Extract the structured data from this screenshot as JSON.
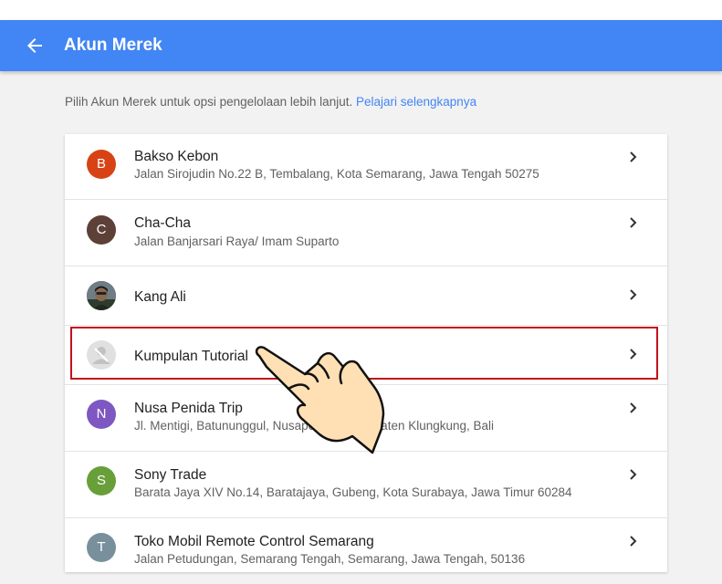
{
  "header": {
    "title": "Akun Merek",
    "back_icon": "arrow-back-icon",
    "bar_color": "#4285f4"
  },
  "intro": {
    "text": "Pilih Akun Merek untuk opsi pengelolaan lebih lanjut.",
    "link": "Pelajari selengkapnya"
  },
  "accounts": [
    {
      "initial": "B",
      "name": "Bakso Kebon",
      "address": "Jalan Sirojudin No.22 B, Tembalang, Kota Semarang, Jawa Tengah 50275",
      "color": "#d84315"
    },
    {
      "initial": "C",
      "name": "Cha-Cha",
      "address": "Jalan Banjarsari Raya/ Imam Suparto",
      "color": "#5d4037"
    },
    {
      "initial": "",
      "name": "Kang Ali",
      "address": "",
      "avatar": "person-photo"
    },
    {
      "initial": "",
      "name": "Kumpulan Tutorial",
      "address": "",
      "avatar": "default-person-icon",
      "highlighted": true
    },
    {
      "initial": "N",
      "name": "Nusa Penida Trip",
      "address": "Jl. Mentigi, Batununggul, Nusapenida, Kabupaten Klungkung, Bali",
      "color": "#7e57c2"
    },
    {
      "initial": "S",
      "name": "Sony Trade",
      "address": "Barata Jaya XIV No.14, Baratajaya, Gubeng, Kota Surabaya, Jawa Timur 60284",
      "color": "#689f38"
    },
    {
      "initial": "T",
      "name": "Toko Mobil Remote Control Semarang",
      "address": "Jalan Petudungan, Semarang Tengah, Semarang, Jawa Tengah, 50136",
      "color": "#78909c"
    }
  ],
  "overlay": {
    "pointer_icon": "pointing-hand-icon",
    "highlight_color": "#c3121a"
  }
}
